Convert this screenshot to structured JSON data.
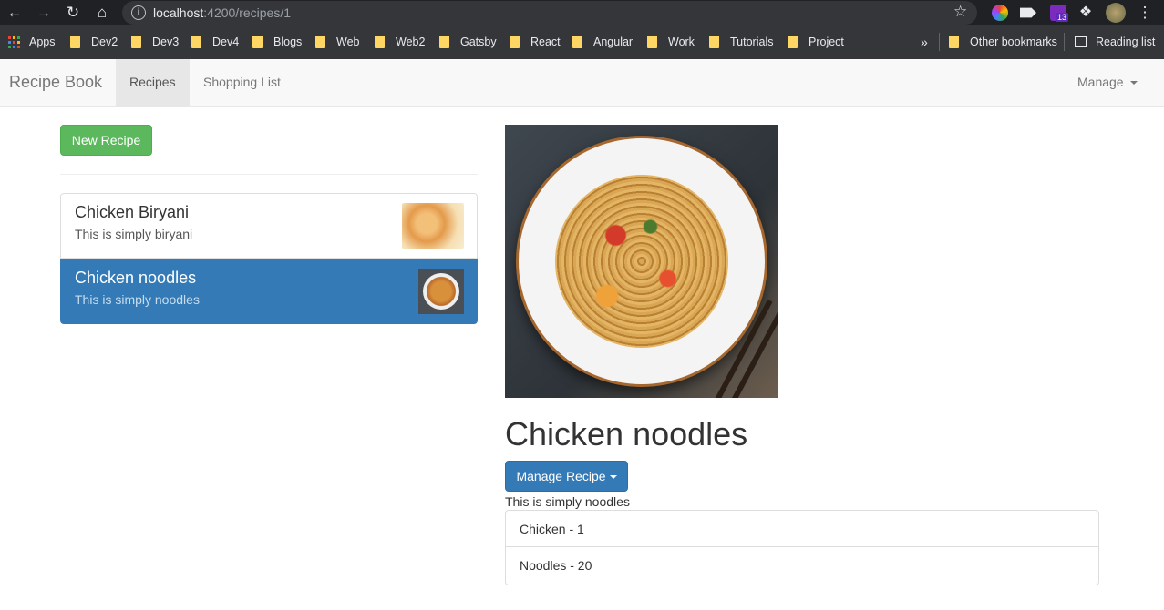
{
  "browser": {
    "url_host": "localhost",
    "url_rest": ":4200/recipes/1",
    "extension_badge": "13",
    "bookmarks": [
      "Apps",
      "Dev2",
      "Dev3",
      "Dev4",
      "Blogs",
      "Web",
      "Web2",
      "Gatsby",
      "React",
      "Angular",
      "Work",
      "Tutorials",
      "Project"
    ],
    "overflow": "»",
    "other_bookmarks": "Other bookmarks",
    "reading_list": "Reading list"
  },
  "navbar": {
    "brand": "Recipe Book",
    "recipes": "Recipes",
    "shopping_list": "Shopping List",
    "manage": "Manage"
  },
  "recipe_list": {
    "new_button": "New Recipe",
    "items": [
      {
        "name": "Chicken Biryani",
        "description": "This is simply biryani"
      },
      {
        "name": "Chicken noodles",
        "description": "This is simply noodles",
        "active": true
      }
    ]
  },
  "detail": {
    "title": "Chicken noodles",
    "manage_button": "Manage Recipe",
    "description": "This is simply noodles",
    "ingredients": [
      "Chicken - 1",
      "Noodles - 20"
    ]
  },
  "colors": {
    "success": "#5cb85c",
    "primary": "#337ab7",
    "browser_chrome": "#202124"
  }
}
